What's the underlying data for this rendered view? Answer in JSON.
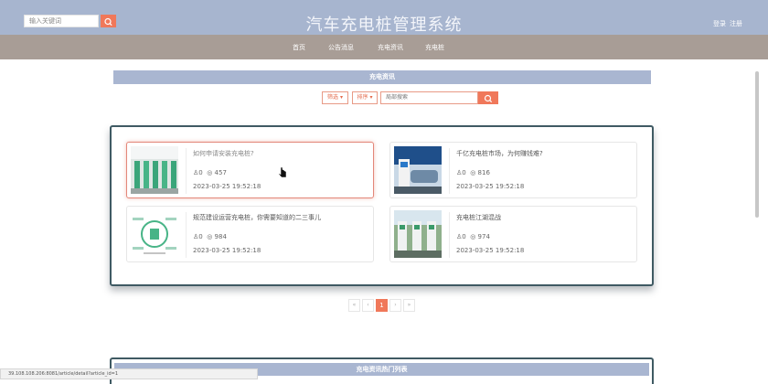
{
  "header": {
    "search_placeholder": "输入关键词",
    "title": "汽车充电桩管理系统",
    "login": "登录",
    "register": "注册"
  },
  "nav": [
    "首页",
    "公告消息",
    "充电资讯",
    "充电桩"
  ],
  "section": {
    "title": "充电资讯",
    "filter_label": "筛选",
    "sort_label": "排序",
    "local_search_placeholder": "局部搜索"
  },
  "articles": [
    {
      "title": "如何申请安装充电桩?",
      "likes": "0",
      "views": "457",
      "date": "2023-03-25 19:52:18"
    },
    {
      "title": "千亿充电桩市场，为何赚钱难?",
      "likes": "0",
      "views": "816",
      "date": "2023-03-25 19:52:18"
    },
    {
      "title": "规范建设运营充电桩，你需要知道的二三事儿",
      "likes": "0",
      "views": "984",
      "date": "2023-03-25 19:52:18"
    },
    {
      "title": "充电桩江湖混战",
      "likes": "0",
      "views": "974",
      "date": "2023-03-25 19:52:18"
    }
  ],
  "pagination": {
    "first": "«",
    "prev": "‹",
    "current": "1",
    "next": "›",
    "last": "»"
  },
  "bottom": {
    "title": "充电资讯热门列表"
  },
  "status_url": "39.108.108.206:8081/article/detail?article_id=1",
  "colors": {
    "accent": "#f0785a",
    "topbar": "#a7b5cf",
    "nav": "#a89d96",
    "panel_border": "#3f5a63"
  }
}
